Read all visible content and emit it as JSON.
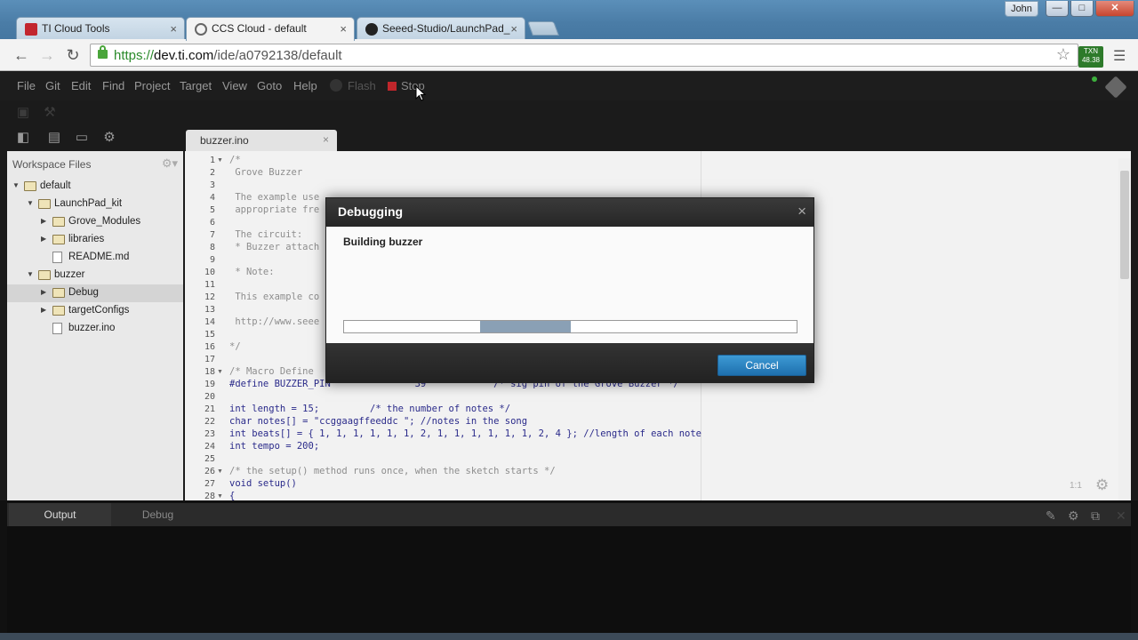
{
  "browser": {
    "tabs": [
      {
        "label": "TI Cloud Tools",
        "active": false
      },
      {
        "label": "CCS Cloud - default",
        "active": true
      },
      {
        "label": "Seeed-Studio/LaunchPad_",
        "active": false
      }
    ],
    "user": "John",
    "url_scheme": "https://",
    "url_host": "dev.ti.com",
    "url_path": "/ide/a0792138/default",
    "extension_text": "TXN 48.38"
  },
  "ide": {
    "menu": [
      "File",
      "Git",
      "Edit",
      "Find",
      "Project",
      "Target",
      "View",
      "Goto",
      "Help"
    ],
    "flash_label": "Flash",
    "stop_label": "Stop",
    "editor_tab": "buzzer.ino",
    "sidebar": {
      "title": "Workspace Files",
      "tree": [
        {
          "label": "default",
          "depth": 0,
          "kind": "project",
          "expanded": true
        },
        {
          "label": "LaunchPad_kit",
          "depth": 1,
          "kind": "folder",
          "expanded": true
        },
        {
          "label": "Grove_Modules",
          "depth": 2,
          "kind": "folder",
          "expanded": false
        },
        {
          "label": "libraries",
          "depth": 2,
          "kind": "folder",
          "expanded": false
        },
        {
          "label": "README.md",
          "depth": 2,
          "kind": "file"
        },
        {
          "label": "buzzer",
          "depth": 1,
          "kind": "folder",
          "expanded": true
        },
        {
          "label": "Debug",
          "depth": 2,
          "kind": "folder",
          "expanded": false,
          "selected": true
        },
        {
          "label": "targetConfigs",
          "depth": 2,
          "kind": "folder",
          "expanded": false
        },
        {
          "label": "buzzer.ino",
          "depth": 2,
          "kind": "file"
        }
      ]
    },
    "code_lines": [
      {
        "n": "1",
        "text": "/*",
        "cls": "c-cm",
        "fold": true
      },
      {
        "n": "2",
        "text": " Grove Buzzer",
        "cls": "c-cm"
      },
      {
        "n": "3",
        "text": "",
        "cls": ""
      },
      {
        "n": "4",
        "text": " The example use",
        "cls": "c-cm"
      },
      {
        "n": "5",
        "text": " appropriate fre",
        "cls": "c-cm"
      },
      {
        "n": "6",
        "text": "",
        "cls": ""
      },
      {
        "n": "7",
        "text": " The circuit:",
        "cls": "c-cm"
      },
      {
        "n": "8",
        "text": " * Buzzer attach",
        "cls": "c-cm"
      },
      {
        "n": "9",
        "text": "",
        "cls": ""
      },
      {
        "n": "10",
        "text": " * Note:",
        "cls": "c-cm"
      },
      {
        "n": "11",
        "text": "",
        "cls": ""
      },
      {
        "n": "12",
        "text": " This example co",
        "cls": "c-cm"
      },
      {
        "n": "13",
        "text": "",
        "cls": ""
      },
      {
        "n": "14",
        "text": " http://www.seee",
        "cls": "c-cm"
      },
      {
        "n": "15",
        "text": "",
        "cls": ""
      },
      {
        "n": "16",
        "text": "*/",
        "cls": "c-cm"
      },
      {
        "n": "17",
        "text": "",
        "cls": ""
      },
      {
        "n": "18",
        "text": "/* Macro Define",
        "cls": "c-cm",
        "fold": true
      },
      {
        "n": "19",
        "text": "#define BUZZER_PIN               39            /* sig pin of the Grove Buzzer */",
        "cls": "c-kw"
      },
      {
        "n": "20",
        "text": "",
        "cls": ""
      },
      {
        "n": "21",
        "text": "int length = 15;         /* the number of notes */",
        "cls": "c-kw"
      },
      {
        "n": "22",
        "text": "char notes[] = \"ccggaagffeeddc \"; //notes in the song",
        "cls": "c-kw"
      },
      {
        "n": "23",
        "text": "int beats[] = { 1, 1, 1, 1, 1, 1, 2, 1, 1, 1, 1, 1, 1, 2, 4 }; //length of each note",
        "cls": "c-kw"
      },
      {
        "n": "24",
        "text": "int tempo = 200;",
        "cls": "c-kw"
      },
      {
        "n": "25",
        "text": "",
        "cls": ""
      },
      {
        "n": "26",
        "text": "/* the setup() method runs once, when the sketch starts */",
        "cls": "c-cm",
        "fold": true
      },
      {
        "n": "27",
        "text": "void setup()",
        "cls": "c-kw"
      },
      {
        "n": "28",
        "text": "{",
        "cls": "c-kw",
        "fold": true
      }
    ],
    "cursor_position": "1:1",
    "bottom_tabs": [
      "Output",
      "Debug"
    ]
  },
  "dialog": {
    "title": "Debugging",
    "message": "Building buzzer",
    "progress_start": 0.3,
    "progress_end": 0.5,
    "cancel_label": "Cancel"
  },
  "colors": {
    "accent_button": "#2a83c3",
    "stop_red": "#c0262b",
    "progress_fill": "#8aa0b5"
  }
}
